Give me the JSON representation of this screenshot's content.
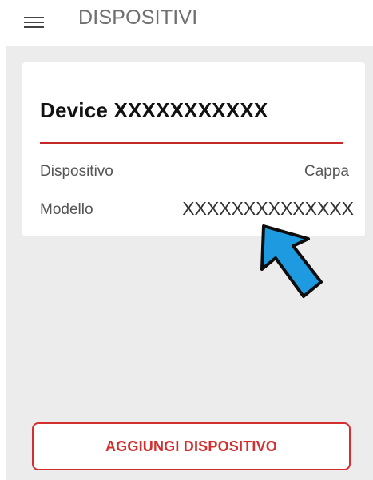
{
  "header": {
    "title": "DISPOSITIVI",
    "menu_icon": "hamburger-menu-icon"
  },
  "device_card": {
    "title": "Device XXXXXXXXXXX",
    "rows": [
      {
        "label": "Dispositivo",
        "value": "Cappa"
      },
      {
        "label": "Modello",
        "value": "XXXXXXXXXXXXXX"
      }
    ]
  },
  "annotation": {
    "icon": "pointer-arrow-icon",
    "color": "#1e9be0"
  },
  "footer": {
    "add_button_label": "AGGIUNGI DISPOSITIVO"
  },
  "colors": {
    "accent": "#d32f2f",
    "background": "#ececec",
    "card": "#ffffff"
  }
}
